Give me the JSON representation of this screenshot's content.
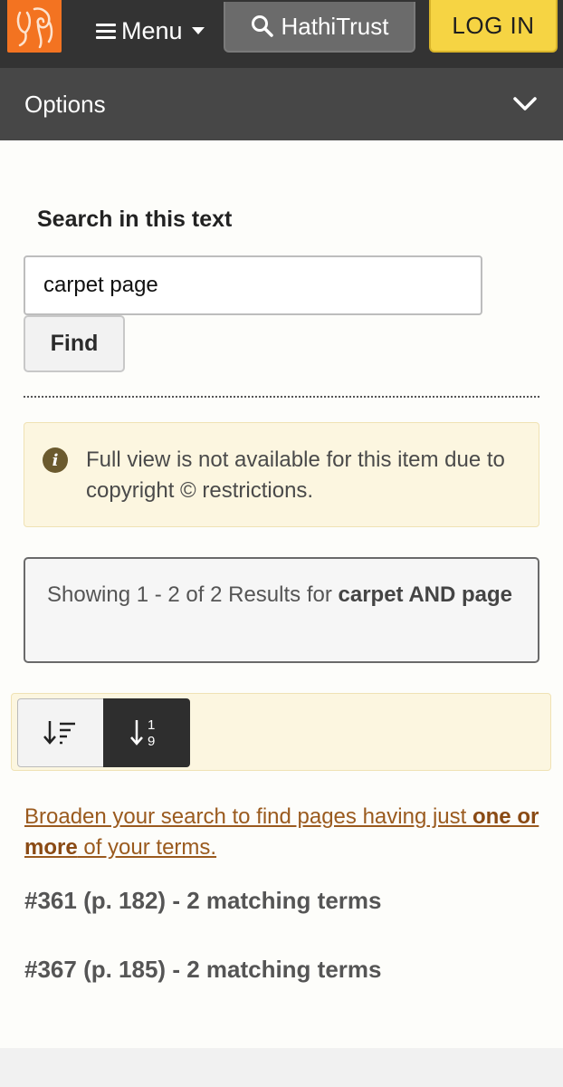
{
  "header": {
    "menu_label": "Menu",
    "search_label": "HathiTrust",
    "login_label": "LOG IN",
    "brand_color": "#f37321",
    "login_color": "#f6d443",
    "icons": {
      "logo": "hathitrust-elephant-logo",
      "menu": "hamburger-icon",
      "search": "magnifier-icon"
    }
  },
  "options": {
    "label": "Options",
    "icon": "chevron-down-icon"
  },
  "search": {
    "heading": "Search in this text",
    "value": "carpet page",
    "button_label": "Find"
  },
  "notice": {
    "icon": "info-icon",
    "text": "Full view is not available for this item due to copyright © restrictions."
  },
  "results": {
    "prefix": "Showing 1 - 2 of 2 Results for ",
    "query": "carpet AND page"
  },
  "sort": {
    "options": [
      {
        "name": "relevance",
        "icon": "sort-relevance-icon",
        "selected": false
      },
      {
        "name": "sequence",
        "icon": "sort-numeric-icon",
        "selected": true
      }
    ]
  },
  "broaden": {
    "part1": "Broaden your search to find pages having just ",
    "emphasis": "one or more",
    "part2": " of your terms."
  },
  "result_items": [
    {
      "label": "#361 (p. 182) - 2 matching terms"
    },
    {
      "label": "#367 (p. 185) - 2 matching terms"
    }
  ]
}
